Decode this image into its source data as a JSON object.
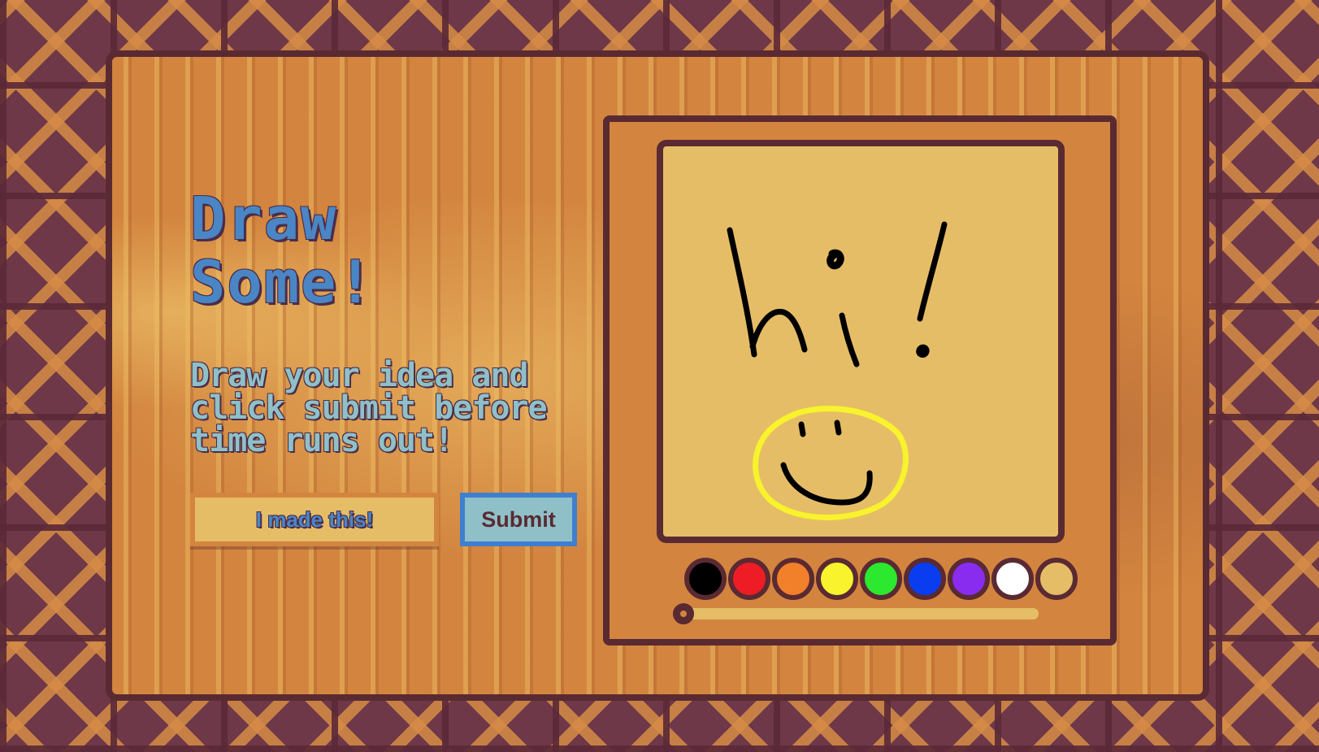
{
  "title": {
    "line1": "Draw",
    "line2": "Some!"
  },
  "instructions": "Draw your idea and click submit before time runs out!",
  "name_input": {
    "placeholder": "I made this!",
    "value": ""
  },
  "submit_label": "Submit",
  "palette": [
    {
      "name": "black",
      "color": "#000000"
    },
    {
      "name": "red",
      "color": "#ee1c25"
    },
    {
      "name": "orange",
      "color": "#f27f2a"
    },
    {
      "name": "yellow",
      "color": "#f8f32c"
    },
    {
      "name": "green",
      "color": "#2ce82f"
    },
    {
      "name": "blue",
      "color": "#0a3cf0"
    },
    {
      "name": "purple",
      "color": "#8a2cf0"
    },
    {
      "name": "white",
      "color": "#ffffff"
    },
    {
      "name": "tan",
      "color": "#e6bd67"
    }
  ],
  "brush_size": 0,
  "colors": {
    "background": "#6e3848",
    "panel": "#d3853f",
    "canvas": "#e6bd67",
    "border": "#5a2a32",
    "title": "#4a86c6",
    "instructions": "#8fc0c8",
    "submit_border": "#3f7fd0"
  }
}
